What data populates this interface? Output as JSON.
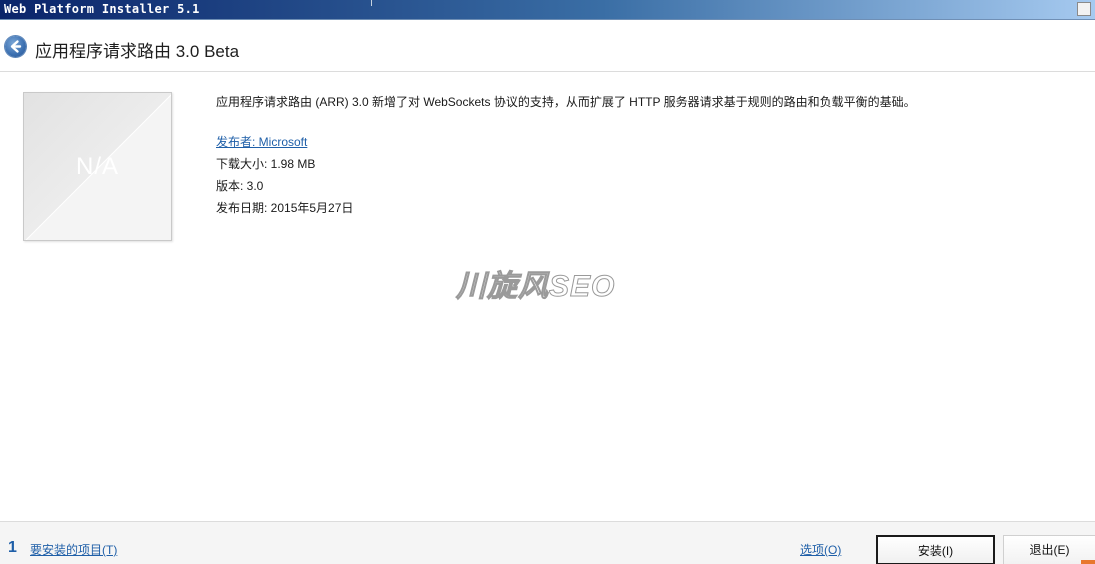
{
  "window": {
    "title": "Web Platform Installer 5.1"
  },
  "header": {
    "title": "应用程序请求路由 3.0 Beta",
    "back_icon": "back-arrow-icon"
  },
  "product": {
    "thumbnail_text": "N/A",
    "description": "应用程序请求路由 (ARR) 3.0 新增了对 WebSockets 协议的支持，从而扩展了 HTTP 服务器请求基于规则的路由和负载平衡的基础。",
    "publisher": "发布者: Microsoft",
    "download_size": "下载大小: 1.98 MB",
    "version": "版本: 3.0",
    "release_date": "发布日期: 2015年5月27日"
  },
  "watermark": "川旋风SEO",
  "footer": {
    "count": "1",
    "items_to_install": "要安装的项目(T)",
    "options": "选项(O)",
    "install": "安装(I)",
    "exit": "退出(E)"
  },
  "colors": {
    "link": "#1f5fa8",
    "titlebar_start": "#0a246a",
    "titlebar_end": "#a6caf0",
    "accent": "#e8772e"
  }
}
